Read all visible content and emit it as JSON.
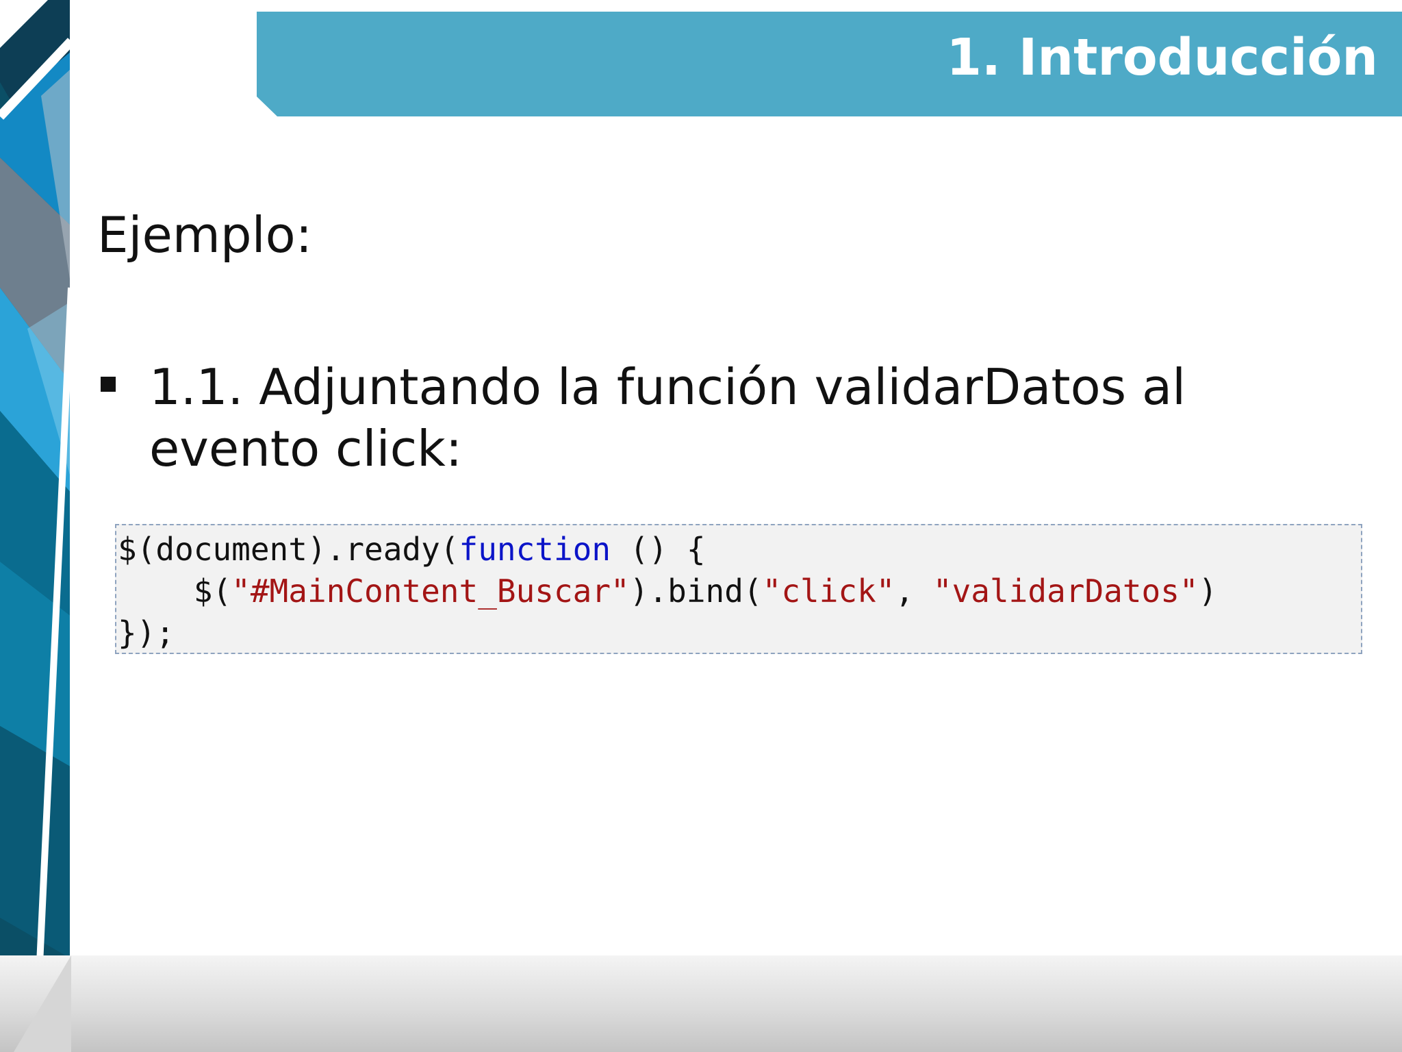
{
  "slide": {
    "title": "1. Introducción",
    "heading": "Ejemplo:",
    "bullet": {
      "line1": "1.1. Adjuntando la función validarDatos al",
      "line2": "evento click:"
    },
    "code": {
      "line1": {
        "a": "$(document).ready(",
        "kw": "function",
        "b": " () {"
      },
      "line2": {
        "indent": "    ",
        "a": "$(",
        "s1": "\"#MainContent_Buscar\"",
        "b": ").bind(",
        "s2": "\"click\"",
        "c": ", ",
        "s3": "\"validarDatos\"",
        "d": ")"
      },
      "line3": "});"
    }
  },
  "colors": {
    "title_bar": "#4eaac7",
    "keyword": "#0b14c8",
    "string": "#a31515",
    "code_border": "#8ea3bf",
    "code_background": "#f2f2f2"
  }
}
